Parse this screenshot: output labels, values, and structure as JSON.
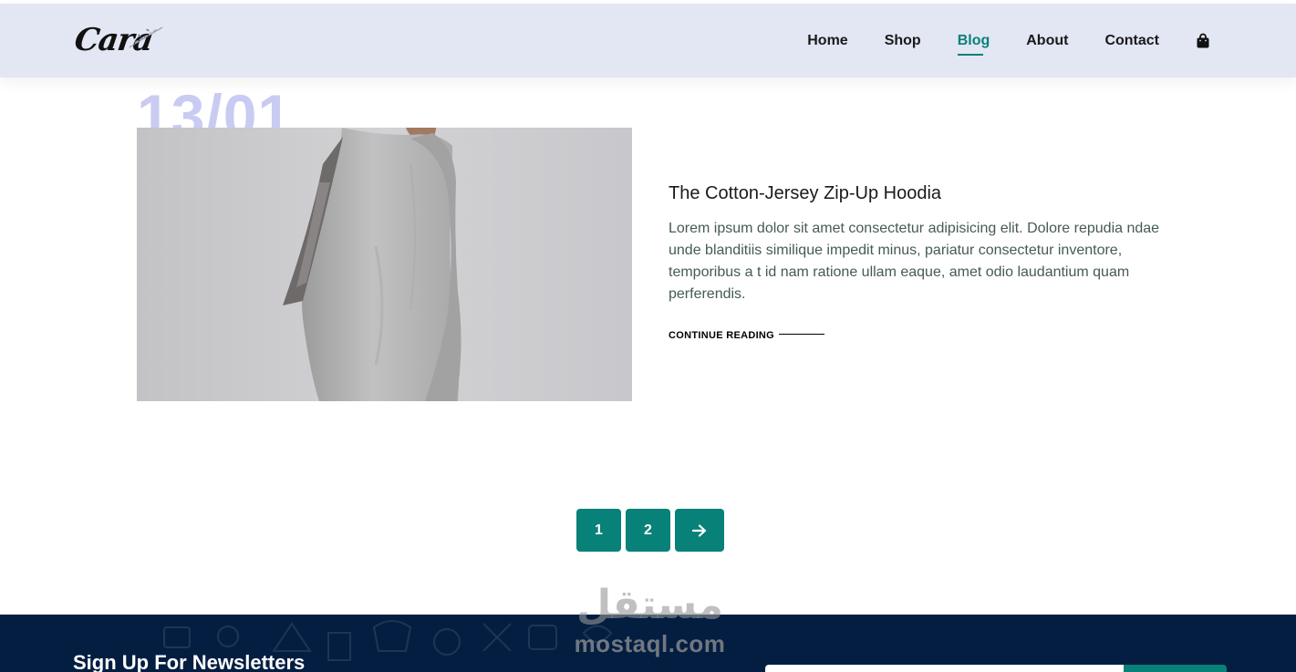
{
  "brand": {
    "logo_text": "Cara"
  },
  "nav": {
    "items": [
      {
        "label": "Home",
        "active": false
      },
      {
        "label": "Shop",
        "active": false
      },
      {
        "label": "Blog",
        "active": true
      },
      {
        "label": "About",
        "active": false
      },
      {
        "label": "Contact",
        "active": false
      }
    ],
    "cart_icon": "shopping-bag-icon"
  },
  "post": {
    "date": "13/01",
    "image": "model-in-grey-knit-sweater",
    "title": "The Cotton-Jersey Zip-Up Hoodia",
    "body": "Lorem ipsum dolor sit amet consectetur adipisicing elit. Dolore repudia ndae unde blanditiis similique impedit minus, pariatur consectetur inventore, temporibus a t id nam ratione ullam eaque, amet odio laudantium quam perferendis.",
    "continue_label": "CONTINUE READING"
  },
  "pagination": {
    "pages": [
      "1",
      "2"
    ],
    "next_icon": "arrow-right-icon"
  },
  "newsletter": {
    "title": "Sign Up For Newsletters"
  },
  "watermark": {
    "arabic": "مستقل",
    "latin": "mostaql.com"
  },
  "colors": {
    "accent": "#088178",
    "header_bg": "#e3e6f3",
    "footer_bg": "#041e42",
    "date_text": "#c9cbf2"
  }
}
